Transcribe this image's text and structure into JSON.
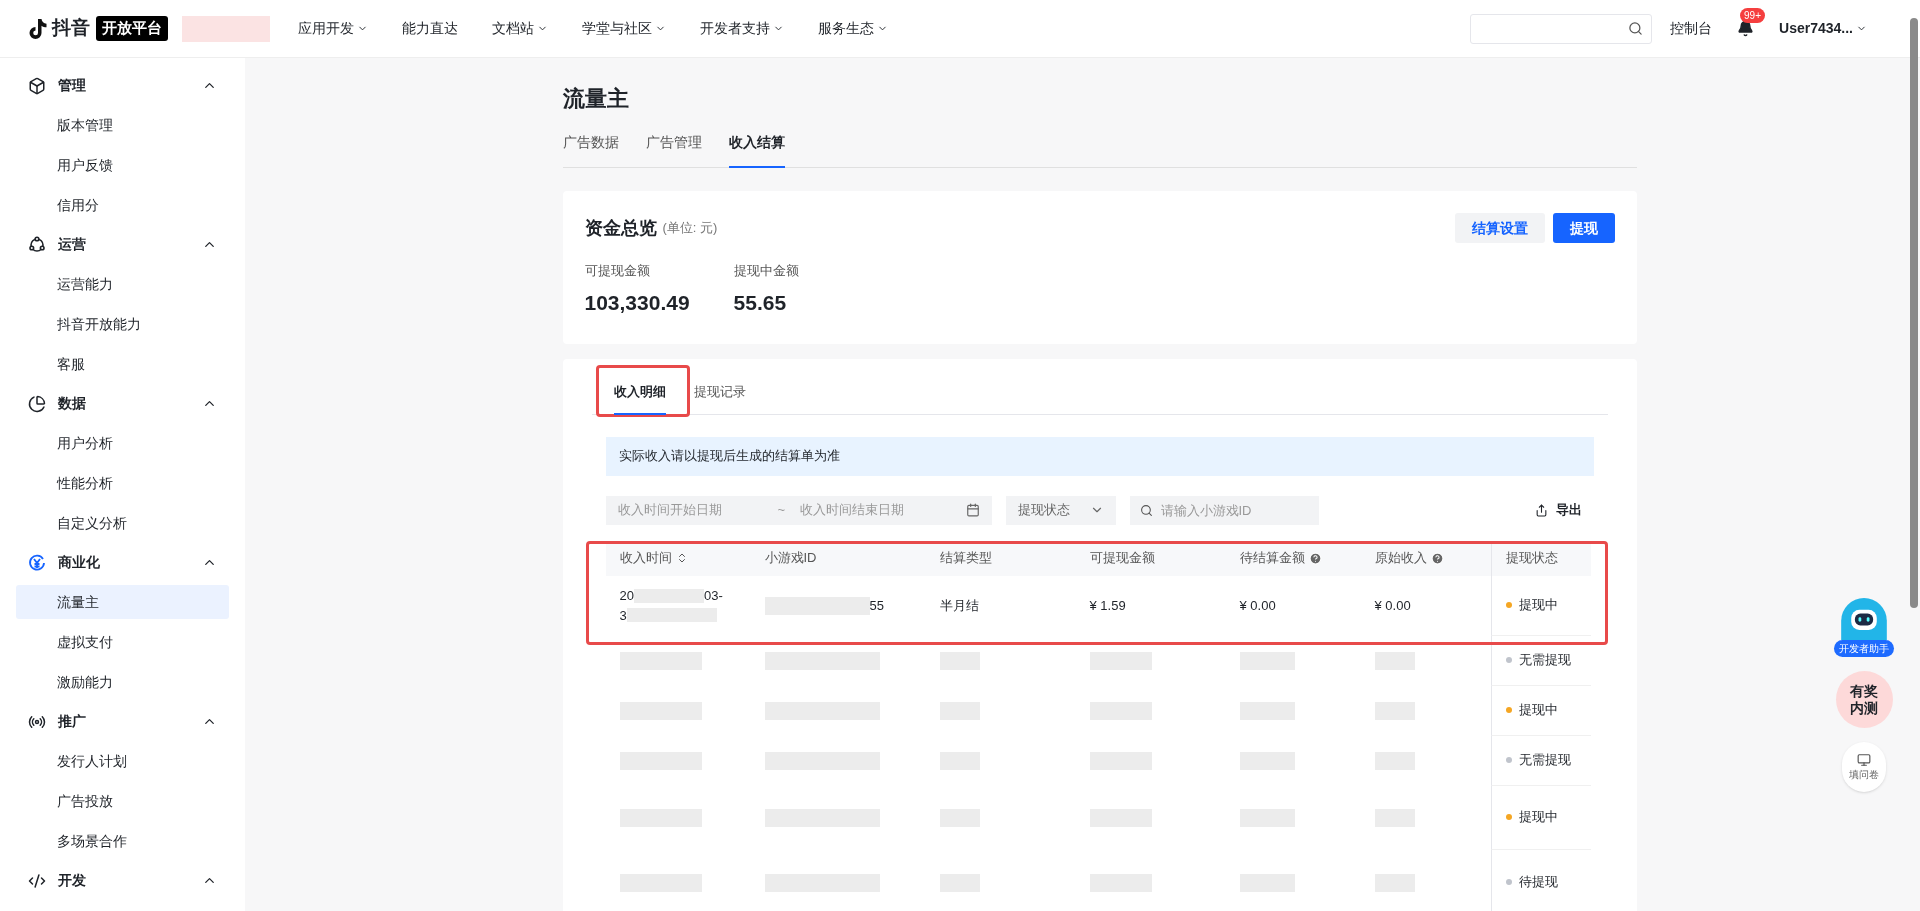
{
  "header": {
    "logo_text": "抖音",
    "logo_badge": "开放平台",
    "nav": [
      {
        "label": "应用开发",
        "dropdown": true
      },
      {
        "label": "能力直达",
        "dropdown": false
      },
      {
        "label": "文档站",
        "dropdown": true
      },
      {
        "label": "学堂与社区",
        "dropdown": true
      },
      {
        "label": "开发者支持",
        "dropdown": true
      },
      {
        "label": "服务生态",
        "dropdown": true
      }
    ],
    "console": "控制台",
    "notification_badge": "99+",
    "user": "User7434..."
  },
  "sidebar": [
    {
      "label": "管理",
      "kind": "cube",
      "expanded": true,
      "children": [
        {
          "label": "版本管理",
          "selected": false
        },
        {
          "label": "用户反馈",
          "selected": false
        },
        {
          "label": "信用分",
          "selected": false
        }
      ]
    },
    {
      "label": "运营",
      "kind": "network",
      "expanded": true,
      "children": [
        {
          "label": "运营能力",
          "selected": false
        },
        {
          "label": "抖音开放能力",
          "selected": false
        },
        {
          "label": "客服",
          "selected": false
        }
      ]
    },
    {
      "label": "数据",
      "kind": "pie",
      "expanded": true,
      "children": [
        {
          "label": "用户分析",
          "selected": false
        },
        {
          "label": "性能分析",
          "selected": false
        },
        {
          "label": "自定义分析",
          "selected": false
        }
      ]
    },
    {
      "label": "商业化",
      "kind": "yen",
      "expanded": true,
      "children": [
        {
          "label": "流量主",
          "selected": true
        },
        {
          "label": "虚拟支付",
          "selected": false
        },
        {
          "label": "激励能力",
          "selected": false
        }
      ]
    },
    {
      "label": "推广",
      "kind": "radio",
      "expanded": true,
      "children": [
        {
          "label": "发行人计划",
          "selected": false
        },
        {
          "label": "广告投放",
          "selected": false
        },
        {
          "label": "多场景合作",
          "selected": false
        }
      ]
    },
    {
      "label": "开发",
      "kind": "code",
      "expanded": true
    }
  ],
  "page_title": "流量主",
  "tabs": [
    {
      "label": "广告数据",
      "selected": false
    },
    {
      "label": "广告管理",
      "selected": false
    },
    {
      "label": "收入结算",
      "selected": true
    }
  ],
  "overview": {
    "title": "资金总览",
    "unit": "(单位: 元)",
    "buttons": [
      {
        "label": "结算设置",
        "kind": "secondary"
      },
      {
        "label": "提现",
        "kind": "primary"
      }
    ],
    "stats": [
      {
        "label": "可提现金额",
        "value": "103,330.49"
      },
      {
        "label": "提现中金额",
        "value": "55.65"
      }
    ]
  },
  "detail_tabs": [
    {
      "label": "收入明细",
      "selected": true
    },
    {
      "label": "提现记录",
      "selected": false
    }
  ],
  "notice": "实际收入请以提现后生成的结算单为准",
  "filters": {
    "start_placeholder": "收入时间开始日期",
    "separator": "~",
    "end_placeholder": "收入时间结束日期",
    "status_select": "提现状态",
    "search_placeholder": "请输入小游戏ID",
    "export": "导出"
  },
  "table": {
    "columns": [
      {
        "label": "收入时间",
        "sortable": true,
        "help": false
      },
      {
        "label": "小游戏ID",
        "sortable": false,
        "help": false
      },
      {
        "label": "结算类型",
        "sortable": false,
        "help": false
      },
      {
        "label": "可提现金额",
        "sortable": false,
        "help": false
      },
      {
        "label": "待结算金额",
        "sortable": false,
        "help": true
      },
      {
        "label": "原始收入",
        "sortable": false,
        "help": true
      },
      {
        "label": "提现状态",
        "sortable": false,
        "help": false
      }
    ],
    "rows": [
      {
        "kind": "visible",
        "time": [
          "20",
          "03-",
          "3"
        ],
        "id_tail": "55",
        "type": "半月结",
        "available": "¥ 1.59",
        "pending": "¥ 0.00",
        "original": "¥ 0.00",
        "status": "提现中",
        "color": "#f5a623"
      },
      {
        "kind": "redacted",
        "status": "无需提现",
        "color": "#c0c4cc"
      },
      {
        "kind": "redacted",
        "status": "提现中",
        "color": "#f5a623"
      },
      {
        "kind": "redacted",
        "status": "无需提现",
        "color": "#c0c4cc"
      },
      {
        "kind": "redacted",
        "status": "提现中",
        "color": "#f5a623"
      },
      {
        "kind": "redacted",
        "status": "待提现",
        "color": "#c0c4cc"
      }
    ]
  },
  "float": {
    "assistant": "开发者助手",
    "beta": [
      "有奖",
      "内测"
    ],
    "survey": "填问卷"
  }
}
